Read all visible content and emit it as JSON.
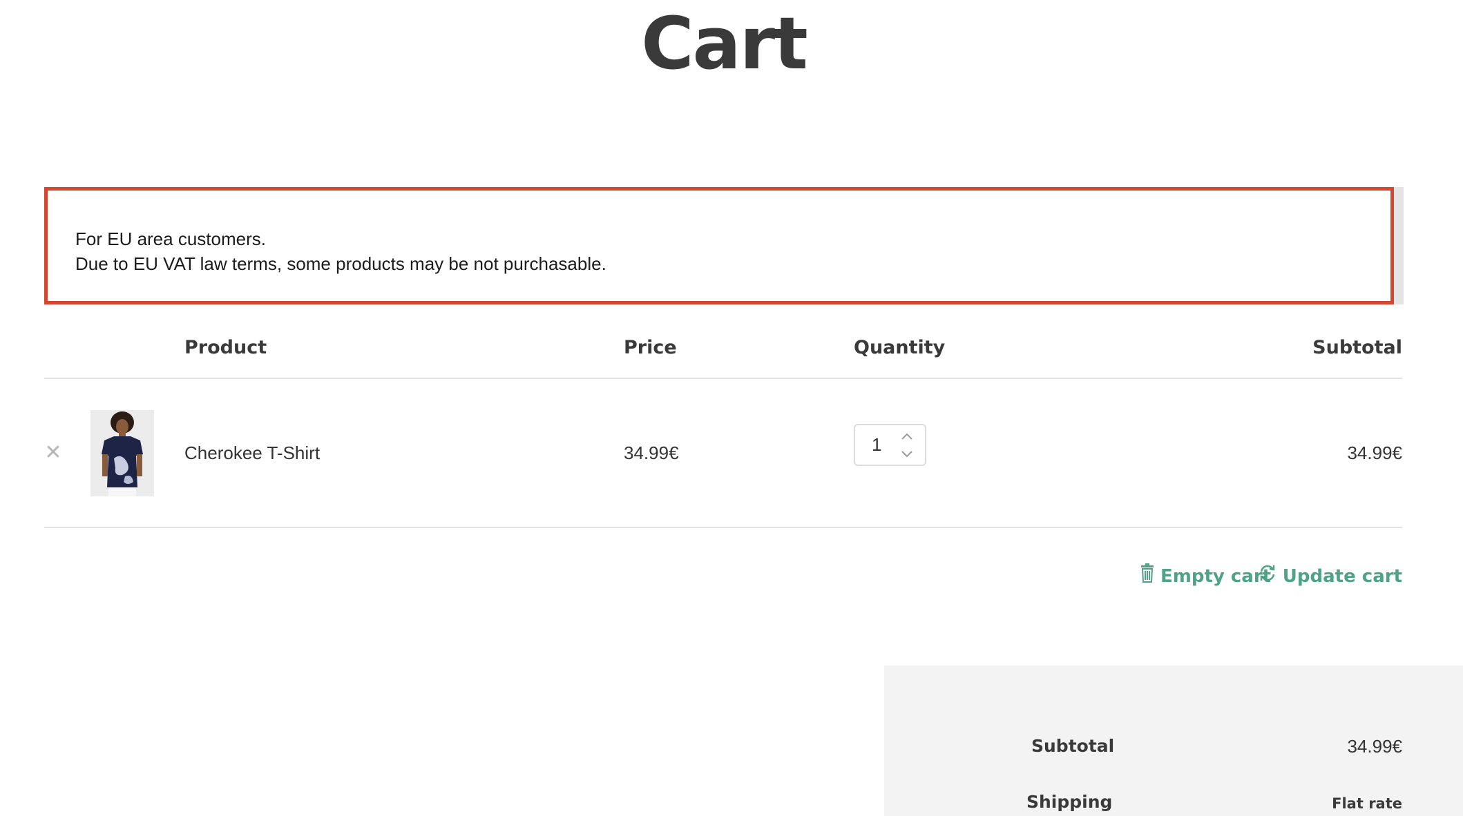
{
  "page": {
    "title": "Cart"
  },
  "notice": {
    "line1": "For EU area customers.",
    "line2": "Due to EU VAT law terms, some products may be not purchasable.",
    "border_color": "#d6452e"
  },
  "table": {
    "headers": {
      "product": "Product",
      "price": "Price",
      "quantity": "Quantity",
      "subtotal": "Subtotal"
    },
    "rows": [
      {
        "name": "Cherokee T-Shirt",
        "price": "34.99€",
        "quantity": "1",
        "subtotal": "34.99€",
        "remove_icon": "close-icon"
      }
    ]
  },
  "actions": {
    "empty_cart": "Empty cart",
    "empty_cart_icon": "trash-icon",
    "update_cart": "Update cart",
    "update_cart_icon": "refresh-icon",
    "color": "#4fa286"
  },
  "totals": {
    "subtotal_label": "Subtotal",
    "subtotal_value": "34.99€",
    "shipping_label": "Shipping",
    "shipping_value": "Flat rate"
  }
}
